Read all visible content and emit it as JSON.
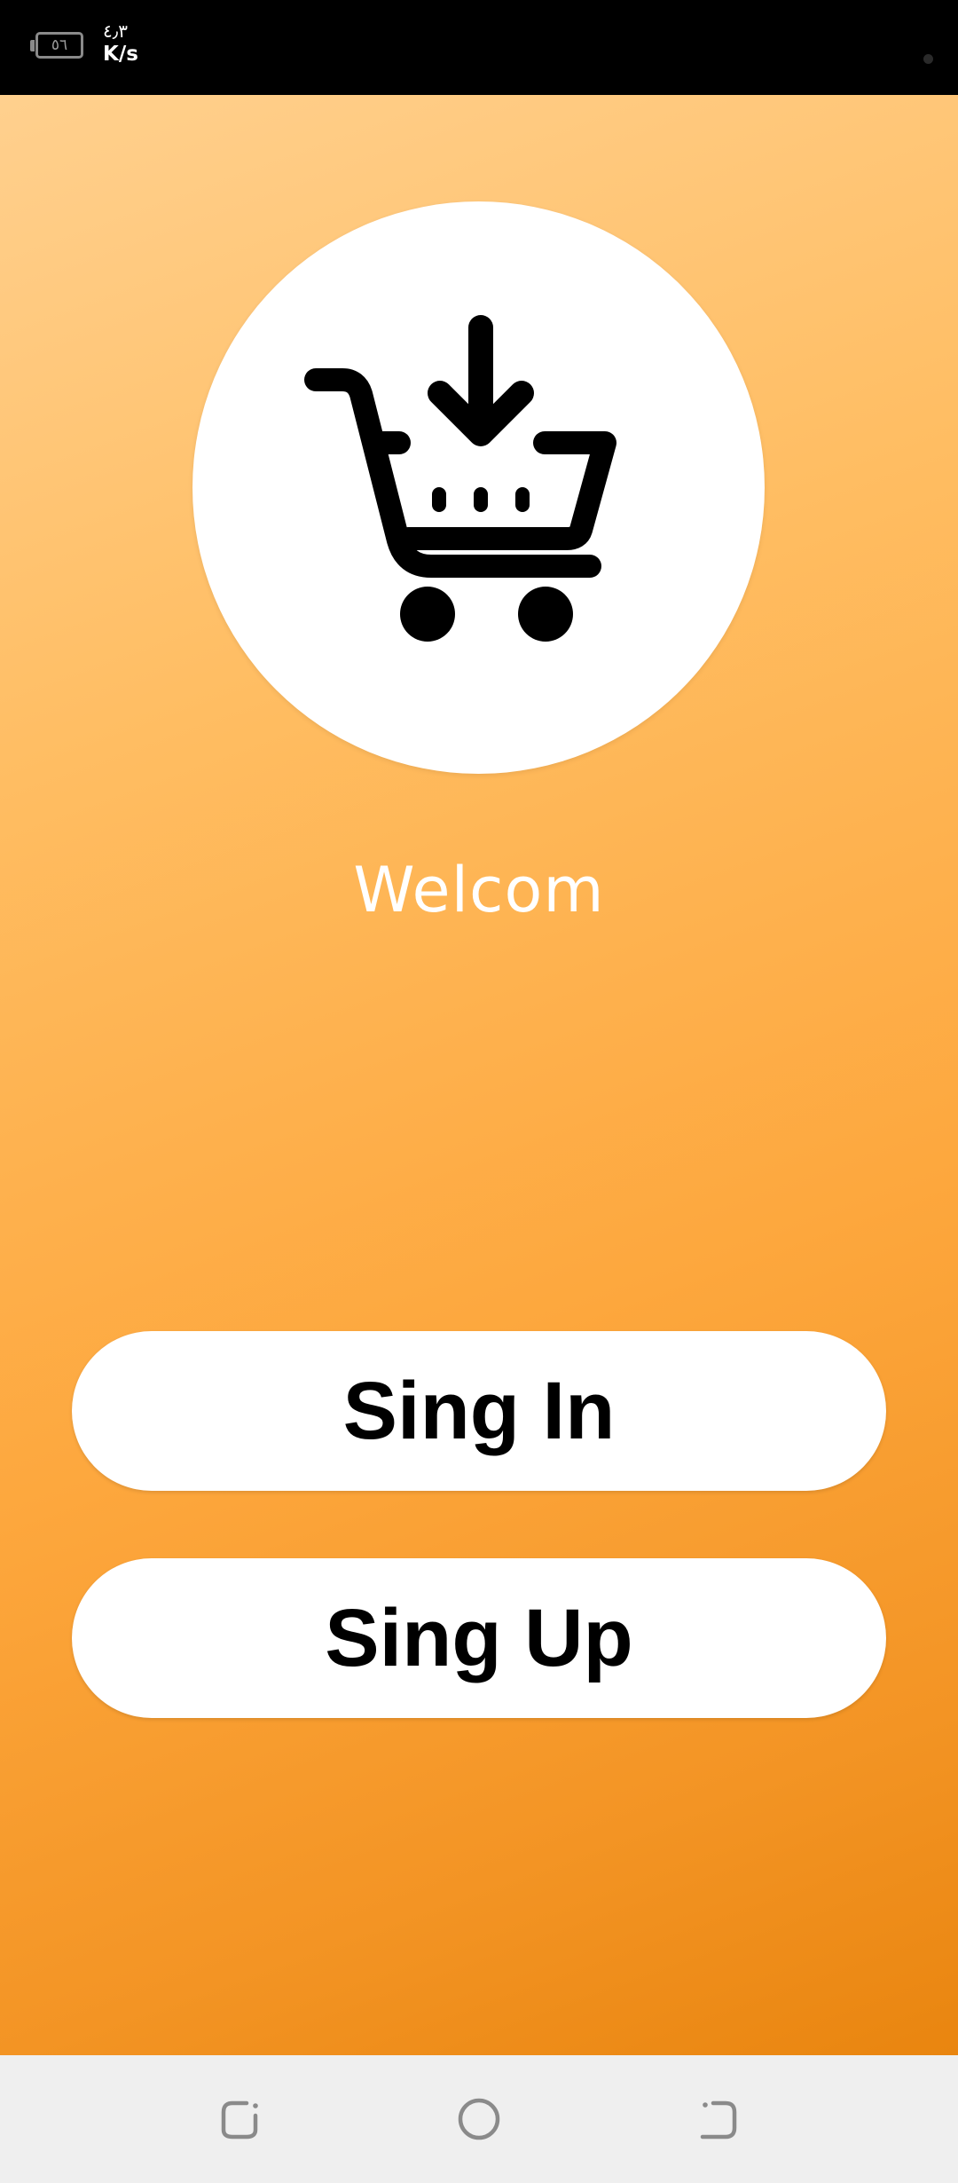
{
  "status_bar": {
    "battery_level": "٥٦",
    "network_speed_value": "٤٫٣",
    "network_speed_unit": "K/s"
  },
  "main": {
    "logo_icon": "cart-download-icon",
    "welcome_text": "Welcom",
    "signin_label": "Sing In",
    "signup_label": "Sing Up"
  },
  "nav_bar": {
    "recent_icon": "recent-apps-icon",
    "home_icon": "home-icon",
    "back_icon": "back-icon"
  },
  "colors": {
    "gradient_top": "#ffd08e",
    "gradient_bottom": "#e9850f",
    "button_bg": "#ffffff",
    "button_text": "#000000",
    "welcome_text": "#ffffff",
    "status_bar_bg": "#000000",
    "nav_bar_bg": "#efefef"
  }
}
